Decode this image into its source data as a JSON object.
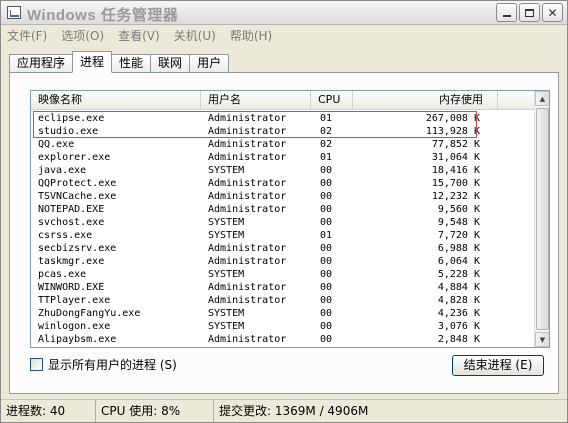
{
  "window": {
    "title": "Windows 任务管理器"
  },
  "menu": {
    "items": [
      "文件(F)",
      "选项(O)",
      "查看(V)",
      "关机(U)",
      "帮助(H)"
    ]
  },
  "tabs": [
    "应用程序",
    "进程",
    "性能",
    "联网",
    "用户"
  ],
  "active_tab": "进程",
  "process_list": {
    "columns": [
      "映像名称",
      "用户名",
      "CPU",
      "内存使用"
    ],
    "rows": [
      [
        "eclipse.exe",
        "Administrator",
        "01",
        "267,008 K"
      ],
      [
        "studio.exe",
        "Administrator",
        "02",
        "113,928 K"
      ],
      [
        "QQ.exe",
        "Administrator",
        "02",
        "77,852 K"
      ],
      [
        "explorer.exe",
        "Administrator",
        "01",
        "31,064 K"
      ],
      [
        "java.exe",
        "SYSTEM",
        "00",
        "18,416 K"
      ],
      [
        "QQProtect.exe",
        "Administrator",
        "00",
        "15,700 K"
      ],
      [
        "TSVNCache.exe",
        "Administrator",
        "00",
        "12,232 K"
      ],
      [
        "NOTEPAD.EXE",
        "Administrator",
        "00",
        "9,560 K"
      ],
      [
        "svchost.exe",
        "SYSTEM",
        "00",
        "9,548 K"
      ],
      [
        "csrss.exe",
        "SYSTEM",
        "01",
        "7,720 K"
      ],
      [
        "secbizsrv.exe",
        "Administrator",
        "00",
        "6,988 K"
      ],
      [
        "taskmgr.exe",
        "Administrator",
        "00",
        "6,064 K"
      ],
      [
        "pcas.exe",
        "SYSTEM",
        "00",
        "5,228 K"
      ],
      [
        "WINWORD.EXE",
        "Administrator",
        "00",
        "4,884 K"
      ],
      [
        "TTPlayer.exe",
        "Administrator",
        "00",
        "4,828 K"
      ],
      [
        "ZhuDongFangYu.exe",
        "SYSTEM",
        "00",
        "4,236 K"
      ],
      [
        "winlogon.exe",
        "SYSTEM",
        "00",
        "3,076 K"
      ],
      [
        "Alipaybsm.exe",
        "Administrator",
        "00",
        "2,848 K"
      ]
    ]
  },
  "show_all_users_label": "显示所有用户的进程 (S)",
  "end_process_label": "结束进程 (E)",
  "status": {
    "process_count": "进程数: 40",
    "cpu_usage": "CPU 使用: 8%",
    "commit_charge": "提交更改: 1369M / 4906M"
  },
  "colors": {
    "highlight_box": "#c0504d",
    "window_bg": "#ece9d8"
  }
}
